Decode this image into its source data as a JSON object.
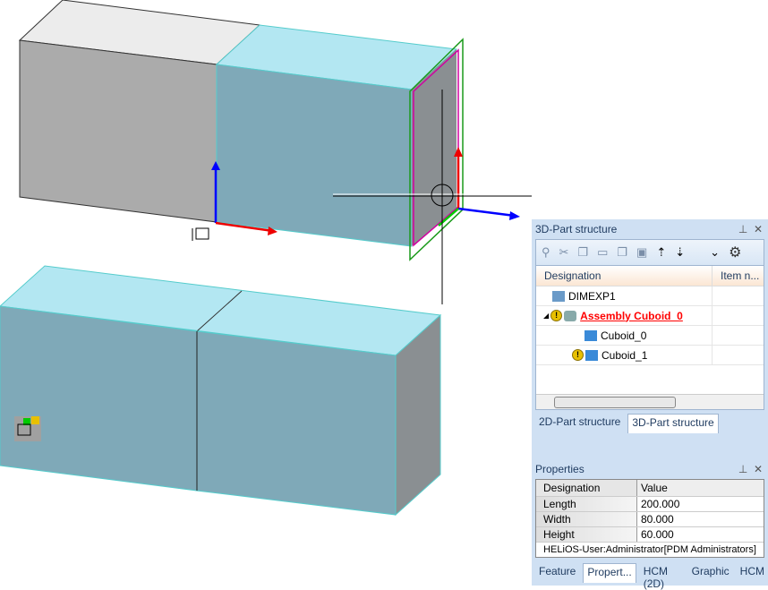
{
  "part_structure": {
    "title": "3D-Part structure",
    "columns": [
      "Designation",
      "Item n..."
    ],
    "items": [
      {
        "label": "DIMEXP1",
        "icon": "drawing-icon"
      },
      {
        "label": "Assembly Cuboid_0",
        "icon": "assembly-icon",
        "warning": true,
        "active": true
      },
      {
        "label": "Cuboid_0",
        "icon": "cuboid-h-icon"
      },
      {
        "label": "Cuboid_1",
        "icon": "cuboid-icon",
        "warning": true
      }
    ],
    "tabs": [
      "2D-Part structure",
      "3D-Part structure"
    ],
    "active_tab": "3D-Part structure"
  },
  "properties": {
    "title": "Properties",
    "columns": [
      "Designation",
      "Value"
    ],
    "rows": [
      {
        "key": "Length",
        "value": "200.000"
      },
      {
        "key": "Width",
        "value": "80.000"
      },
      {
        "key": "Height",
        "value": "60.000"
      }
    ],
    "status": "HELiOS-User:Administrator[PDM Administrators]"
  },
  "bottom_tabs": [
    "Feature",
    "Propert...",
    "HCM (2D)",
    "Graphic",
    "HCM"
  ],
  "active_bottom_tab": "Propert...",
  "colors": {
    "active_item": "#ff0000",
    "cuboid_cyan": "#7fa9b8",
    "panel_bg": "#cfe0f3"
  }
}
